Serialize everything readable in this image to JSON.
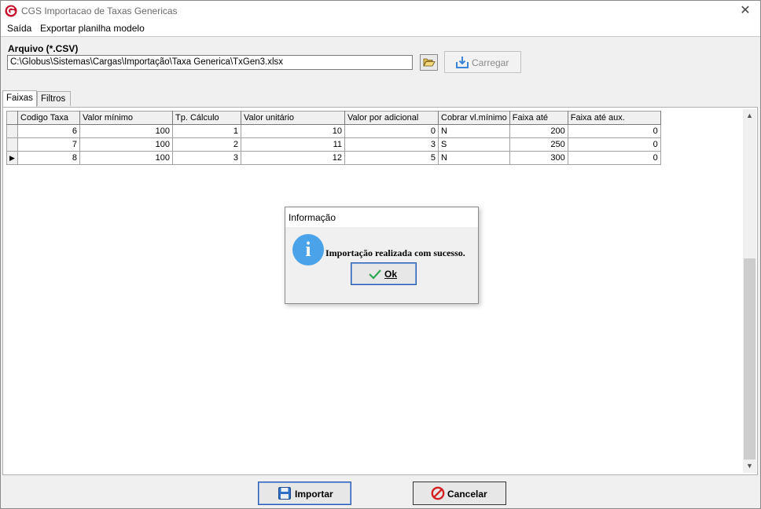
{
  "window": {
    "title": "CGS Importacao de Taxas Genericas",
    "close_glyph": "✕"
  },
  "menu": {
    "items": [
      {
        "label": "Saída"
      },
      {
        "label": "Exportar planilha modelo"
      }
    ]
  },
  "arquivo": {
    "label": "Arquivo (*.CSV)",
    "path": "C:\\Globus\\Sistemas\\Cargas\\Importação\\Taxa Generica\\TxGen3.xlsx",
    "carregar_label": "Carregar"
  },
  "tabs": [
    {
      "label": "Faixas"
    },
    {
      "label": "Filtros"
    }
  ],
  "grid": {
    "columns": [
      "Codigo Taxa",
      "Valor mínimo",
      "Tp. Cálculo",
      "Valor unitário",
      "Valor por adicional",
      "Cobrar vl.mínimo",
      "Faixa até",
      "Faixa até aux."
    ],
    "rows": [
      [
        "6",
        "100",
        "1",
        "10",
        "0",
        "N",
        "200",
        "0"
      ],
      [
        "7",
        "100",
        "2",
        "11",
        "3",
        "S",
        "250",
        "0"
      ],
      [
        "8",
        "100",
        "3",
        "12",
        "5",
        "N",
        "300",
        "0"
      ]
    ],
    "current_row_indicator": "▶"
  },
  "dialog": {
    "title": "Informação",
    "message": "Importação realizada com sucesso.",
    "ok_label": "Ok",
    "icon": "info-icon"
  },
  "buttons": {
    "importar_label": "Importar",
    "cancelar_label": "Cancelar"
  },
  "colors": {
    "accent": "#2a5cae",
    "info": "#4aa3e8",
    "cancel_red": "#d42020"
  }
}
